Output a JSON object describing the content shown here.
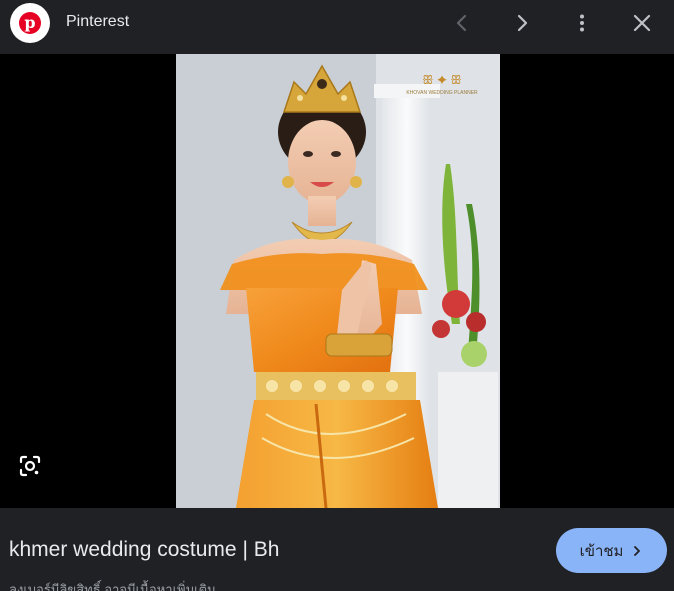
{
  "header": {
    "source_name": "Pinterest",
    "logo_icon": "pinterest-logo-icon",
    "logo_letter": "p",
    "prev_icon": "chevron-left-icon",
    "next_icon": "chevron-right-icon",
    "more_icon": "more-vert-icon",
    "close_icon": "close-icon"
  },
  "image": {
    "subject": "woman in traditional khmer wedding costume",
    "watermark_text": "KHOVAN WEDDING PLANNER",
    "lens_icon": "google-lens-icon"
  },
  "footer": {
    "caption": "khmer wedding costume | Bh",
    "visit_label": "เข้าชม",
    "visit_icon": "chevron-right-icon",
    "subcaption": "ลงเบอร์มีลิขสิทธิ์ อาจมีเนื้อหาเพิ่มเติม"
  },
  "colors": {
    "background": "#202124",
    "visit_button": "#8ab4f8",
    "text": "#e8eaed",
    "pinterest_red": "#e60023"
  }
}
